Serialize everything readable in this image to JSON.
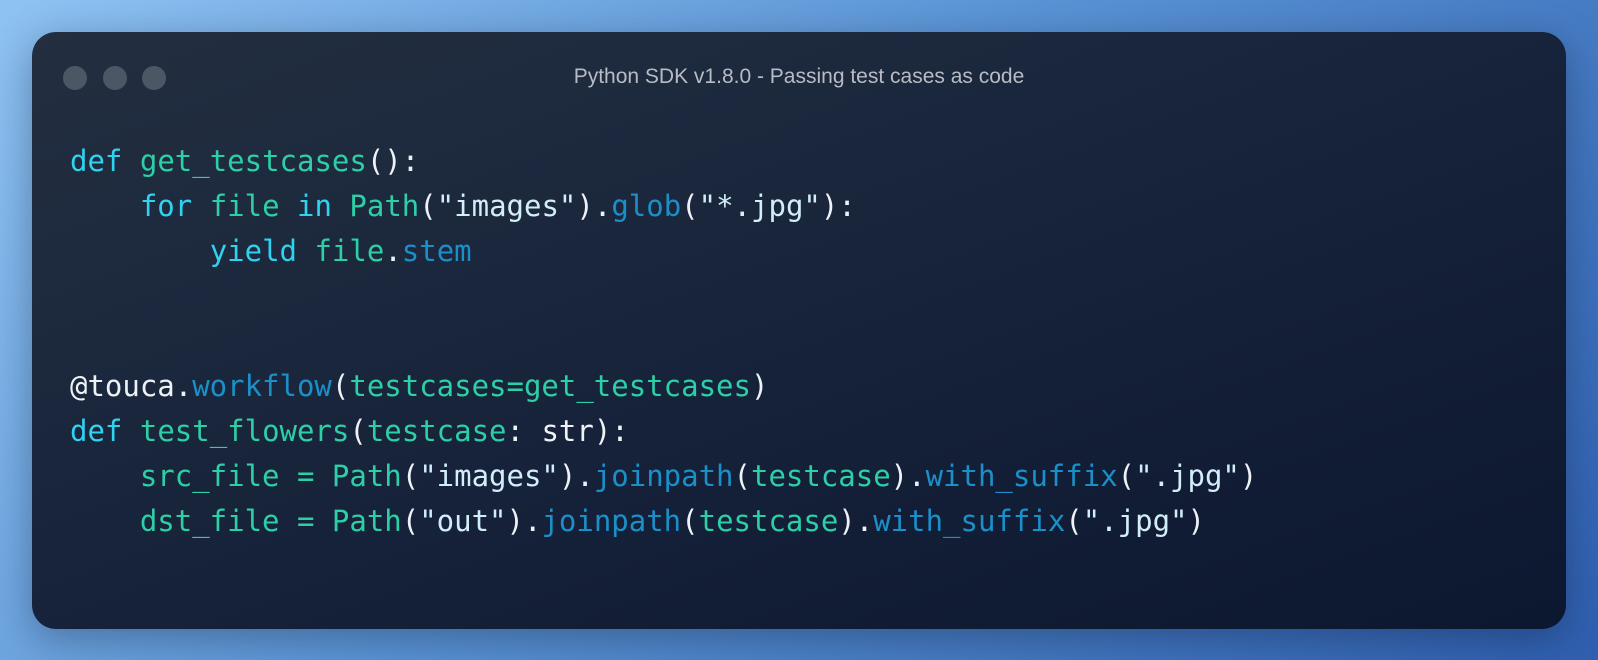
{
  "window": {
    "title": "Python SDK v1.8.0 - Passing test cases as code"
  },
  "code_lines": [
    [
      {
        "t": "def",
        "c": "kw"
      },
      {
        "t": " ",
        "c": "pl"
      },
      {
        "t": "get_testcases",
        "c": "nm"
      },
      {
        "t": "():",
        "c": "pl"
      }
    ],
    [
      {
        "t": "    ",
        "c": "pl"
      },
      {
        "t": "for",
        "c": "kw"
      },
      {
        "t": " ",
        "c": "pl"
      },
      {
        "t": "file",
        "c": "nm"
      },
      {
        "t": " ",
        "c": "pl"
      },
      {
        "t": "in",
        "c": "kw"
      },
      {
        "t": " ",
        "c": "pl"
      },
      {
        "t": "Path",
        "c": "nm"
      },
      {
        "t": "(",
        "c": "pl"
      },
      {
        "t": "\"images\"",
        "c": "st"
      },
      {
        "t": ").",
        "c": "pl"
      },
      {
        "t": "glob",
        "c": "mt"
      },
      {
        "t": "(",
        "c": "pl"
      },
      {
        "t": "\"*.jpg\"",
        "c": "st"
      },
      {
        "t": "):",
        "c": "pl"
      }
    ],
    [
      {
        "t": "        ",
        "c": "pl"
      },
      {
        "t": "yield",
        "c": "kw"
      },
      {
        "t": " ",
        "c": "pl"
      },
      {
        "t": "file",
        "c": "nm"
      },
      {
        "t": ".",
        "c": "pl"
      },
      {
        "t": "stem",
        "c": "mt"
      }
    ],
    [],
    [],
    [
      {
        "t": "@touca.",
        "c": "pl"
      },
      {
        "t": "workflow",
        "c": "mt"
      },
      {
        "t": "(",
        "c": "pl"
      },
      {
        "t": "testcases=get_testcases",
        "c": "nm"
      },
      {
        "t": ")",
        "c": "pl"
      }
    ],
    [
      {
        "t": "def",
        "c": "kw"
      },
      {
        "t": " ",
        "c": "pl"
      },
      {
        "t": "test_flowers",
        "c": "nm"
      },
      {
        "t": "(",
        "c": "pl"
      },
      {
        "t": "testcase",
        "c": "nm"
      },
      {
        "t": ": str):",
        "c": "pl"
      }
    ],
    [
      {
        "t": "    ",
        "c": "pl"
      },
      {
        "t": "src_file = Path",
        "c": "nm"
      },
      {
        "t": "(",
        "c": "pl"
      },
      {
        "t": "\"images\"",
        "c": "st"
      },
      {
        "t": ").",
        "c": "pl"
      },
      {
        "t": "joinpath",
        "c": "mt"
      },
      {
        "t": "(",
        "c": "pl"
      },
      {
        "t": "testcase",
        "c": "nm"
      },
      {
        "t": ").",
        "c": "pl"
      },
      {
        "t": "with_suffix",
        "c": "mt"
      },
      {
        "t": "(",
        "c": "pl"
      },
      {
        "t": "\".jpg\"",
        "c": "st"
      },
      {
        "t": ")",
        "c": "pl"
      }
    ],
    [
      {
        "t": "    ",
        "c": "pl"
      },
      {
        "t": "dst_file = Path",
        "c": "nm"
      },
      {
        "t": "(",
        "c": "pl"
      },
      {
        "t": "\"out\"",
        "c": "st"
      },
      {
        "t": ").",
        "c": "pl"
      },
      {
        "t": "joinpath",
        "c": "mt"
      },
      {
        "t": "(",
        "c": "pl"
      },
      {
        "t": "testcase",
        "c": "nm"
      },
      {
        "t": ").",
        "c": "pl"
      },
      {
        "t": "with_suffix",
        "c": "mt"
      },
      {
        "t": "(",
        "c": "pl"
      },
      {
        "t": "\".jpg\"",
        "c": "st"
      },
      {
        "t": ")",
        "c": "pl"
      }
    ]
  ]
}
